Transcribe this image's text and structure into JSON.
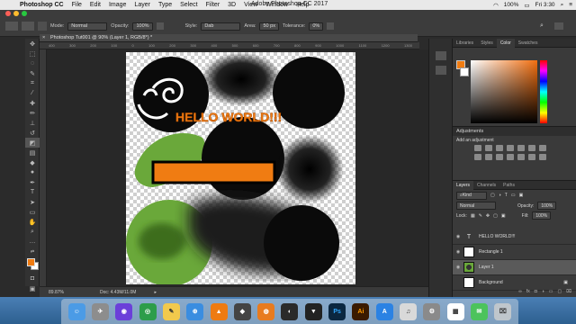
{
  "menubar": {
    "app": "Photoshop CC",
    "items": [
      "File",
      "Edit",
      "Image",
      "Layer",
      "Type",
      "Select",
      "Filter",
      "3D",
      "View",
      "Window",
      "Help"
    ],
    "window_title": "Adobe Photoshop CC 2017",
    "battery": "100%",
    "clock": "Fri 3:30"
  },
  "options": {
    "mode_label": "Mode:",
    "mode_value": "Normal",
    "opacity_label": "Opacity:",
    "opacity_value": "100%",
    "style_label": "Style:",
    "style_value": "Dab",
    "area_label": "Area:",
    "area_value": "50 px",
    "tolerance_label": "Tolerance:",
    "tolerance_value": "0%"
  },
  "document": {
    "tab_title": "Photoshop Tut001 @ 90% (Layer 1, RGB/8*) *",
    "text_layer": "HELLO WORLD!!!",
    "text_color": "#f07c12",
    "bar_color": "#f07c12",
    "circle_color": "#0a0a0a",
    "green_color": "#6aa83a"
  },
  "ruler": [
    "400",
    "300",
    "200",
    "100",
    "0",
    "100",
    "200",
    "300",
    "400",
    "500",
    "600",
    "700",
    "800",
    "900",
    "1000",
    "1100",
    "1200",
    "1300"
  ],
  "status": {
    "zoom": "89.87%",
    "doc": "Doc: 4.43M/11.0M"
  },
  "panels": {
    "color_tabs": [
      "Libraries",
      "Styles",
      "Color",
      "Swatches"
    ],
    "active_color_tab": "Color",
    "fg_color": "#f07c12",
    "adjustments_title": "Adjustments",
    "adjustments_hint": "Add an adjustment",
    "layer_tabs": [
      "Layers",
      "Channels",
      "Paths"
    ],
    "kind_label": "Kind",
    "blend_mode": "Normal",
    "opacity_label": "Opacity:",
    "opacity_value": "100%",
    "lock_label": "Lock:",
    "fill_label": "Fill:",
    "fill_value": "100%",
    "layers": [
      {
        "name": "HELLO WORLD!!!",
        "type": "text",
        "visible": true
      },
      {
        "name": "Rectangle 1",
        "type": "shape",
        "visible": true
      },
      {
        "name": "Layer 1",
        "type": "pixel",
        "visible": true,
        "active": true
      },
      {
        "name": "Background",
        "type": "background",
        "visible": false
      }
    ]
  },
  "dock": [
    {
      "name": "finder-icon",
      "color": "#4b9be6",
      "glyph": "☺"
    },
    {
      "name": "launchpad-icon",
      "color": "#8d8d8d",
      "glyph": "✈"
    },
    {
      "name": "siri-icon",
      "color": "#6b3fd9",
      "glyph": "◉"
    },
    {
      "name": "chrome-icon",
      "color": "#2d9d4a",
      "glyph": "◎"
    },
    {
      "name": "notes-icon",
      "color": "#f2c94c",
      "glyph": "✎"
    },
    {
      "name": "safari-icon",
      "color": "#3a8de0",
      "glyph": "⊕"
    },
    {
      "name": "vlc-icon",
      "color": "#ee7b12",
      "glyph": "▲"
    },
    {
      "name": "unity-icon",
      "color": "#444",
      "glyph": "◆"
    },
    {
      "name": "blender-icon",
      "color": "#e87b1f",
      "glyph": "◍"
    },
    {
      "name": "gamemaker-icon",
      "color": "#2a2a2a",
      "glyph": "◐"
    },
    {
      "name": "cat-app-icon",
      "color": "#222",
      "glyph": "▼"
    },
    {
      "name": "photoshop-icon",
      "color": "#0b2740",
      "glyph": "Ps"
    },
    {
      "name": "illustrator-icon",
      "color": "#3a1a00",
      "glyph": "Ai"
    },
    {
      "name": "appstore-icon",
      "color": "#2b82e3",
      "glyph": "A"
    },
    {
      "name": "music-icon",
      "color": "#d9d9d9",
      "glyph": "♫"
    },
    {
      "name": "system-prefs-icon",
      "color": "#8a8a8a",
      "glyph": "⚙"
    },
    {
      "name": "calendar-icon",
      "color": "#ffffff",
      "glyph": "▦"
    },
    {
      "name": "messages-icon",
      "color": "#4cc35c",
      "glyph": "✉"
    },
    {
      "name": "trash-icon",
      "color": "#bfc6cc",
      "glyph": "⌧"
    }
  ]
}
